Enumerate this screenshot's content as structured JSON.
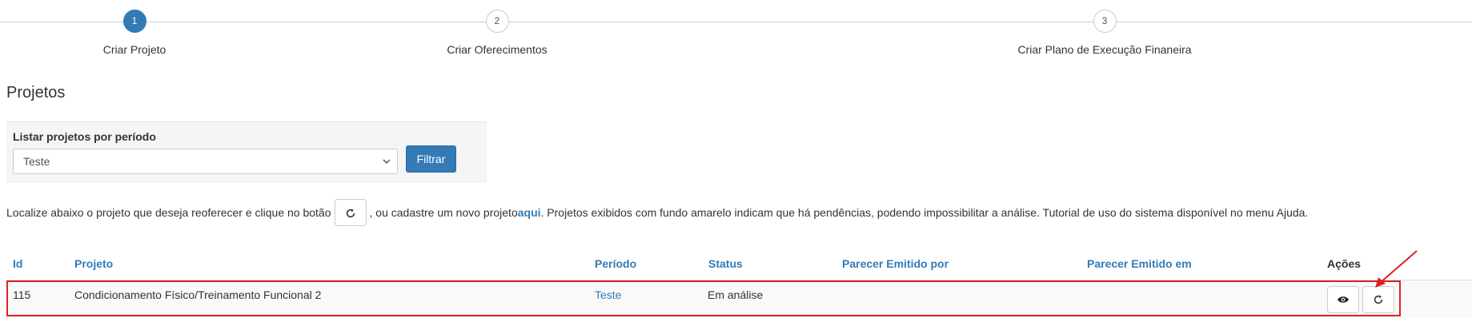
{
  "wizard": {
    "steps": [
      {
        "number": "1",
        "label": "Criar Projeto",
        "active": true
      },
      {
        "number": "2",
        "label": "Criar Oferecimentos",
        "active": false
      },
      {
        "number": "3",
        "label": "Criar Plano de Execução Finaneira",
        "active": false
      }
    ]
  },
  "page_title": "Projetos",
  "filter": {
    "label": "Listar projetos por período",
    "selected": "Teste",
    "button_label": "Filtrar"
  },
  "instruction": {
    "before": "Localize abaixo o projeto que deseja reoferecer e clique no botão",
    "middle": ", ou cadastre um novo projeto ",
    "link": "aqui",
    "after": ". Projetos exibidos com fundo amarelo indicam que há pendências, podendo impossibilitar a análise. Tutorial de uso do sistema disponível no menu Ajuda."
  },
  "table": {
    "headers": [
      "Id",
      "Projeto",
      "Período",
      "Status",
      "Parecer Emitido por",
      "Parecer Emitido em",
      "Ações"
    ],
    "rows": [
      {
        "id": "115",
        "projeto": "Condicionamento Físico/Treinamento Funcional 2",
        "periodo": "Teste",
        "status": "Em análise",
        "parecer_por": "",
        "parecer_em": ""
      }
    ]
  },
  "icons": {
    "inline_button": "refresh-icon",
    "view": "eye-icon",
    "reoffer": "refresh-icon"
  },
  "colors": {
    "primary": "#337ab7",
    "highlight": "#e02020"
  }
}
